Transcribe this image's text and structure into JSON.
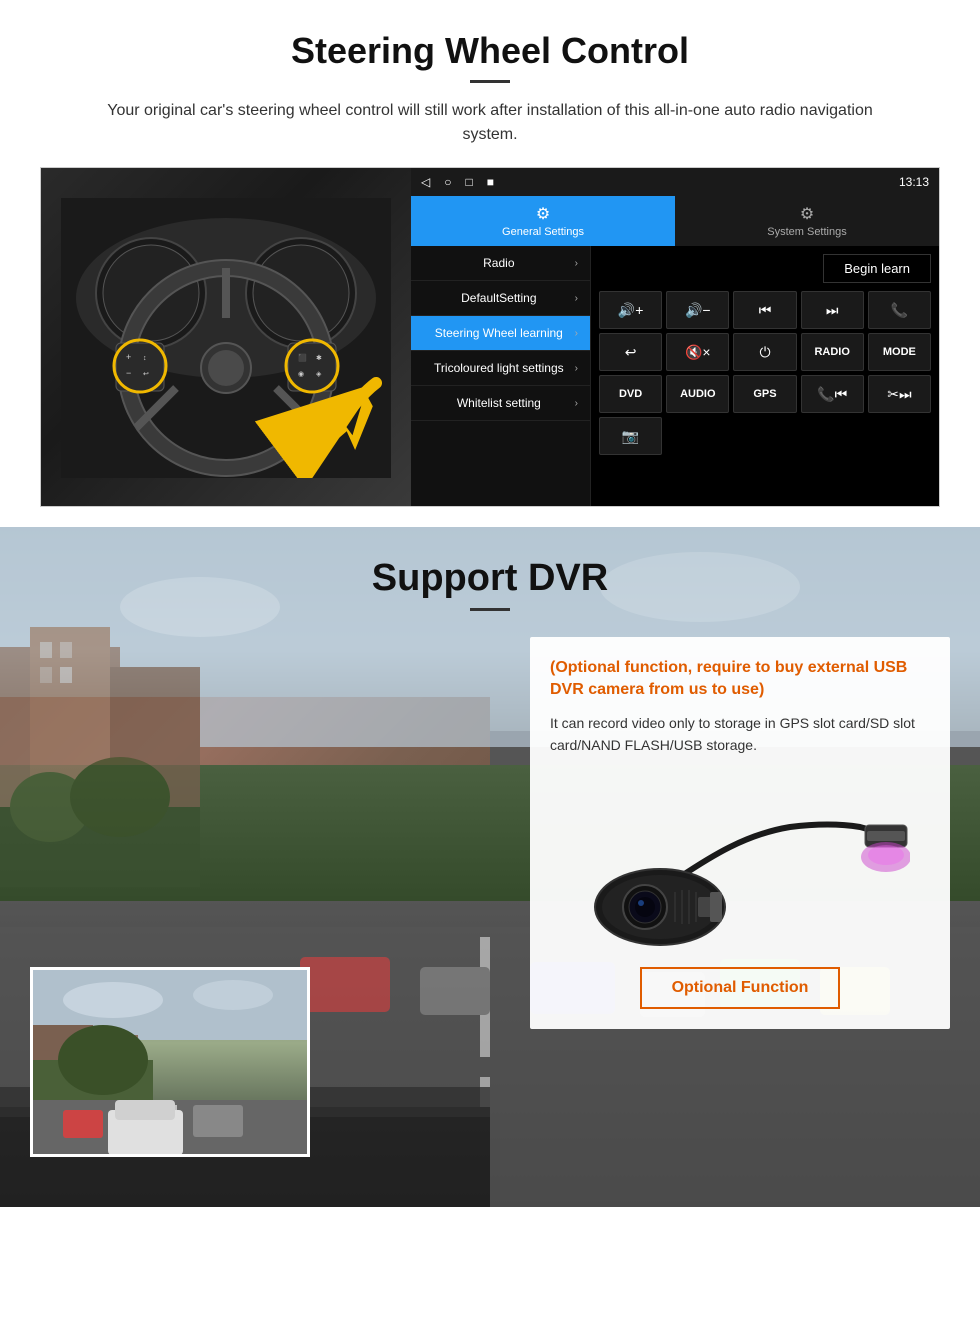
{
  "section1": {
    "title": "Steering Wheel Control",
    "description": "Your original car's steering wheel control will still work after installation of this all-in-one auto radio navigation system.",
    "status_bar": {
      "time": "13:13",
      "icons": [
        "◁",
        "○",
        "□",
        "■"
      ]
    },
    "tabs": [
      {
        "label": "General Settings",
        "icon": "⚙",
        "active": true
      },
      {
        "label": "System Settings",
        "icon": "⚙",
        "active": false
      }
    ],
    "menu_items": [
      {
        "label": "Radio",
        "active": false
      },
      {
        "label": "DefaultSetting",
        "active": false
      },
      {
        "label": "Steering Wheel learning",
        "active": true
      },
      {
        "label": "Tricoloured light settings",
        "active": false
      },
      {
        "label": "Whitelist setting",
        "active": false
      }
    ],
    "begin_learn_label": "Begin learn",
    "controls": [
      {
        "icon": "◀◀+",
        "type": "icon"
      },
      {
        "icon": "◀◀−",
        "type": "icon"
      },
      {
        "icon": "⏮",
        "type": "icon"
      },
      {
        "icon": "⏭",
        "type": "icon"
      },
      {
        "icon": "📞",
        "type": "icon"
      },
      {
        "icon": "↩",
        "type": "icon"
      },
      {
        "icon": "🔇×",
        "type": "icon"
      },
      {
        "icon": "⏻",
        "type": "icon"
      },
      {
        "label": "RADIO",
        "type": "text"
      },
      {
        "label": "MODE",
        "type": "text"
      },
      {
        "label": "DVD",
        "type": "text"
      },
      {
        "label": "AUDIO",
        "type": "text"
      },
      {
        "label": "GPS",
        "type": "text"
      },
      {
        "icon": "📞⏮",
        "type": "icon"
      },
      {
        "icon": "✂⏭",
        "type": "icon"
      },
      {
        "icon": "📷",
        "type": "icon"
      }
    ]
  },
  "section2": {
    "title": "Support DVR",
    "info_box": {
      "title": "(Optional function, require to buy external USB DVR camera from us to use)",
      "text": "It can record video only to storage in GPS slot card/SD slot card/NAND FLASH/USB storage.",
      "button_label": "Optional Function"
    }
  }
}
